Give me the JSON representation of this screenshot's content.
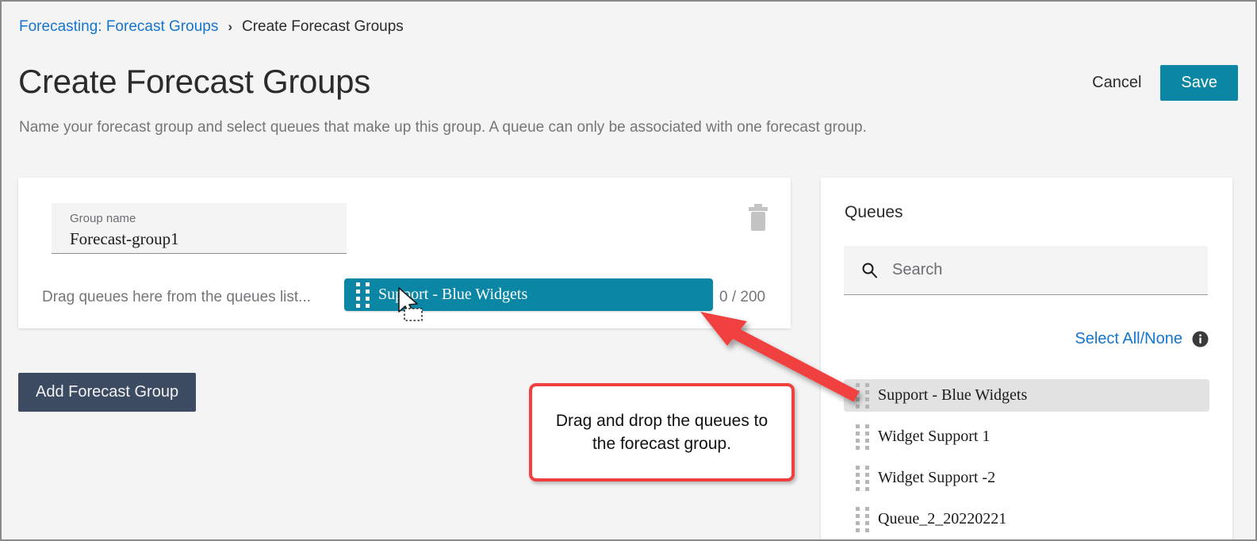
{
  "breadcrumb": {
    "parent": "Forecasting: Forecast Groups",
    "separator": "›",
    "current": "Create Forecast Groups"
  },
  "header": {
    "title": "Create Forecast Groups",
    "subtitle": "Name your forecast group and select queues that make up this group. A queue can only be associated with one forecast group.",
    "cancel_label": "Cancel",
    "save_label": "Save",
    "save_color": "#0b87a5"
  },
  "group_card": {
    "name_label": "Group name",
    "name_value": "Forecast-group1",
    "drop_hint": "Drag queues here from the queues list...",
    "counter": "0 / 200",
    "delete_icon": "trash-icon"
  },
  "drag_chip": {
    "label": "Support - Blue Widgets",
    "handle_icon": "drag-handle-icon",
    "color": "#0b87a5"
  },
  "actions": {
    "add_group_label": "Add Forecast Group",
    "add_group_color": "#3c4b61"
  },
  "queues_panel": {
    "title": "Queues",
    "search_placeholder": "Search",
    "search_value": "",
    "search_icon": "search-icon",
    "select_all_label": "Select All/None",
    "info_icon": "info-icon",
    "items": [
      {
        "label": "Support - Blue Widgets",
        "selected": true
      },
      {
        "label": "Widget Support 1",
        "selected": false
      },
      {
        "label": "Widget Support -2",
        "selected": false
      },
      {
        "label": "Queue_2_20220221",
        "selected": false
      }
    ]
  },
  "annotation": {
    "callout_text": "Drag and drop the queues to the forecast group.",
    "accent_color": "#f04040",
    "arrow_icon": "red-arrow-annotation"
  },
  "cursor": {
    "icon": "mouse-pointer-drag-cursor"
  }
}
